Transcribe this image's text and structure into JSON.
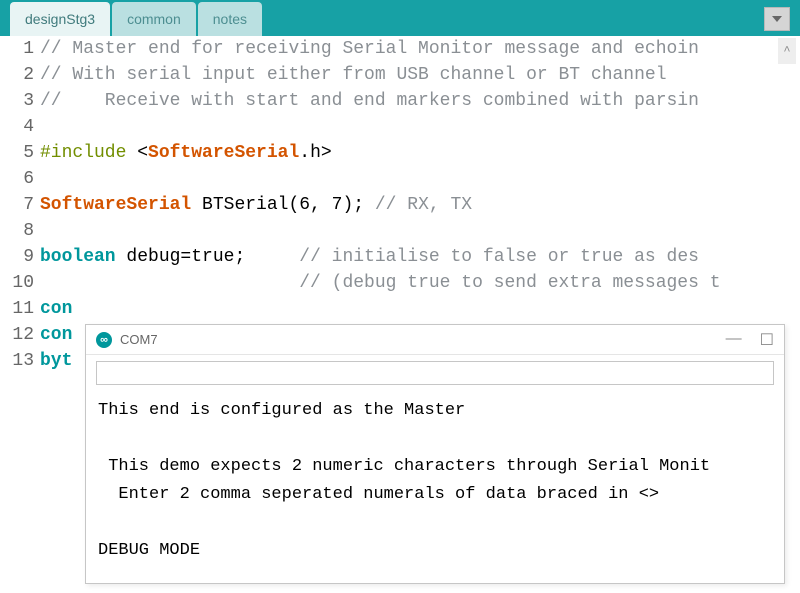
{
  "tabs": {
    "active": "designStg3",
    "items": [
      "designStg3",
      "common",
      "notes"
    ]
  },
  "code": {
    "lines": [
      {
        "n": 1,
        "frags": [
          {
            "cls": "c-comment",
            "t": "// Master end for receiving Serial Monitor message and echoin"
          }
        ]
      },
      {
        "n": 2,
        "frags": [
          {
            "cls": "c-comment",
            "t": "// With serial input either from USB channel or BT channel"
          }
        ]
      },
      {
        "n": 3,
        "frags": [
          {
            "cls": "c-comment",
            "t": "//    Receive with start and end markers combined with parsin"
          }
        ]
      },
      {
        "n": 4,
        "frags": []
      },
      {
        "n": 5,
        "frags": [
          {
            "cls": "c-preproc",
            "t": "#include "
          },
          {
            "cls": "",
            "t": "<"
          },
          {
            "cls": "c-type-orange",
            "t": "SoftwareSerial"
          },
          {
            "cls": "",
            "t": ".h>"
          }
        ]
      },
      {
        "n": 6,
        "frags": []
      },
      {
        "n": 7,
        "frags": [
          {
            "cls": "c-type-orange",
            "t": "SoftwareSerial"
          },
          {
            "cls": "",
            "t": " BTSerial(6, 7); "
          },
          {
            "cls": "c-comment",
            "t": "// RX, TX"
          }
        ]
      },
      {
        "n": 8,
        "frags": []
      },
      {
        "n": 9,
        "frags": [
          {
            "cls": "c-bool",
            "t": "boolean"
          },
          {
            "cls": "",
            "t": " debug=true;     "
          },
          {
            "cls": "c-comment",
            "t": "// initialise to false or true as des"
          }
        ]
      },
      {
        "n": 10,
        "frags": [
          {
            "cls": "",
            "t": "                        "
          },
          {
            "cls": "c-comment",
            "t": "// (debug true to send extra messages t"
          }
        ]
      },
      {
        "n": 11,
        "frags": [
          {
            "cls": "c-bool",
            "t": "con"
          }
        ]
      },
      {
        "n": 12,
        "frags": [
          {
            "cls": "c-bool",
            "t": "con"
          }
        ]
      },
      {
        "n": 13,
        "frags": [
          {
            "cls": "c-bool",
            "t": "byt"
          }
        ]
      }
    ]
  },
  "serial": {
    "title": "COM7",
    "input_value": "",
    "output": [
      "This end is configured as the Master",
      "",
      " This demo expects 2 numeric characters through Serial Monit",
      "  Enter 2 comma seperated numerals of data braced in <>",
      "",
      "DEBUG MODE"
    ]
  }
}
